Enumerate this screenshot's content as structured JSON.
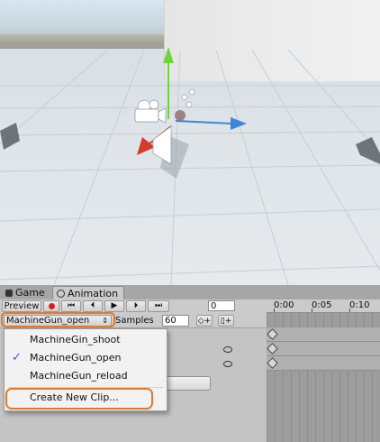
{
  "tabs": {
    "game_label": "Game",
    "animation_label": "Animation"
  },
  "toolbar": {
    "preview_label": "Preview",
    "prev_key_glyph": "⏮",
    "step_back_glyph": "⏴",
    "play_glyph": "▶",
    "step_fwd_glyph": "⏵",
    "next_key_glyph": "⏭",
    "frame_value": "0"
  },
  "clip": {
    "selected": "MachineGun_open",
    "dropdown_arrow": "⇕",
    "samples_label": "Samples",
    "samples_value": "60",
    "add_keyframe_glyph": "◇+",
    "add_event_glyph": "▯+"
  },
  "timeline": {
    "ticks": [
      "0:00",
      "0:05",
      "0:10"
    ]
  },
  "clip_menu": {
    "items": [
      {
        "label": "MachineGin_shoot",
        "checked": false
      },
      {
        "label": "MachineGun_open",
        "checked": true
      },
      {
        "label": "MachineGun_reload",
        "checked": false
      }
    ],
    "check_glyph": "✓",
    "create_label": "Create New Clip..."
  },
  "colors": {
    "highlight": "#e07b2c",
    "record": "#d62020",
    "check": "#2a61c9"
  },
  "icons": [
    "record-icon",
    "gizmo-y-arrow-icon",
    "gizmo-x-arrow-icon",
    "gizmo-z-arrow-icon",
    "camera-icon",
    "eye-icon"
  ]
}
